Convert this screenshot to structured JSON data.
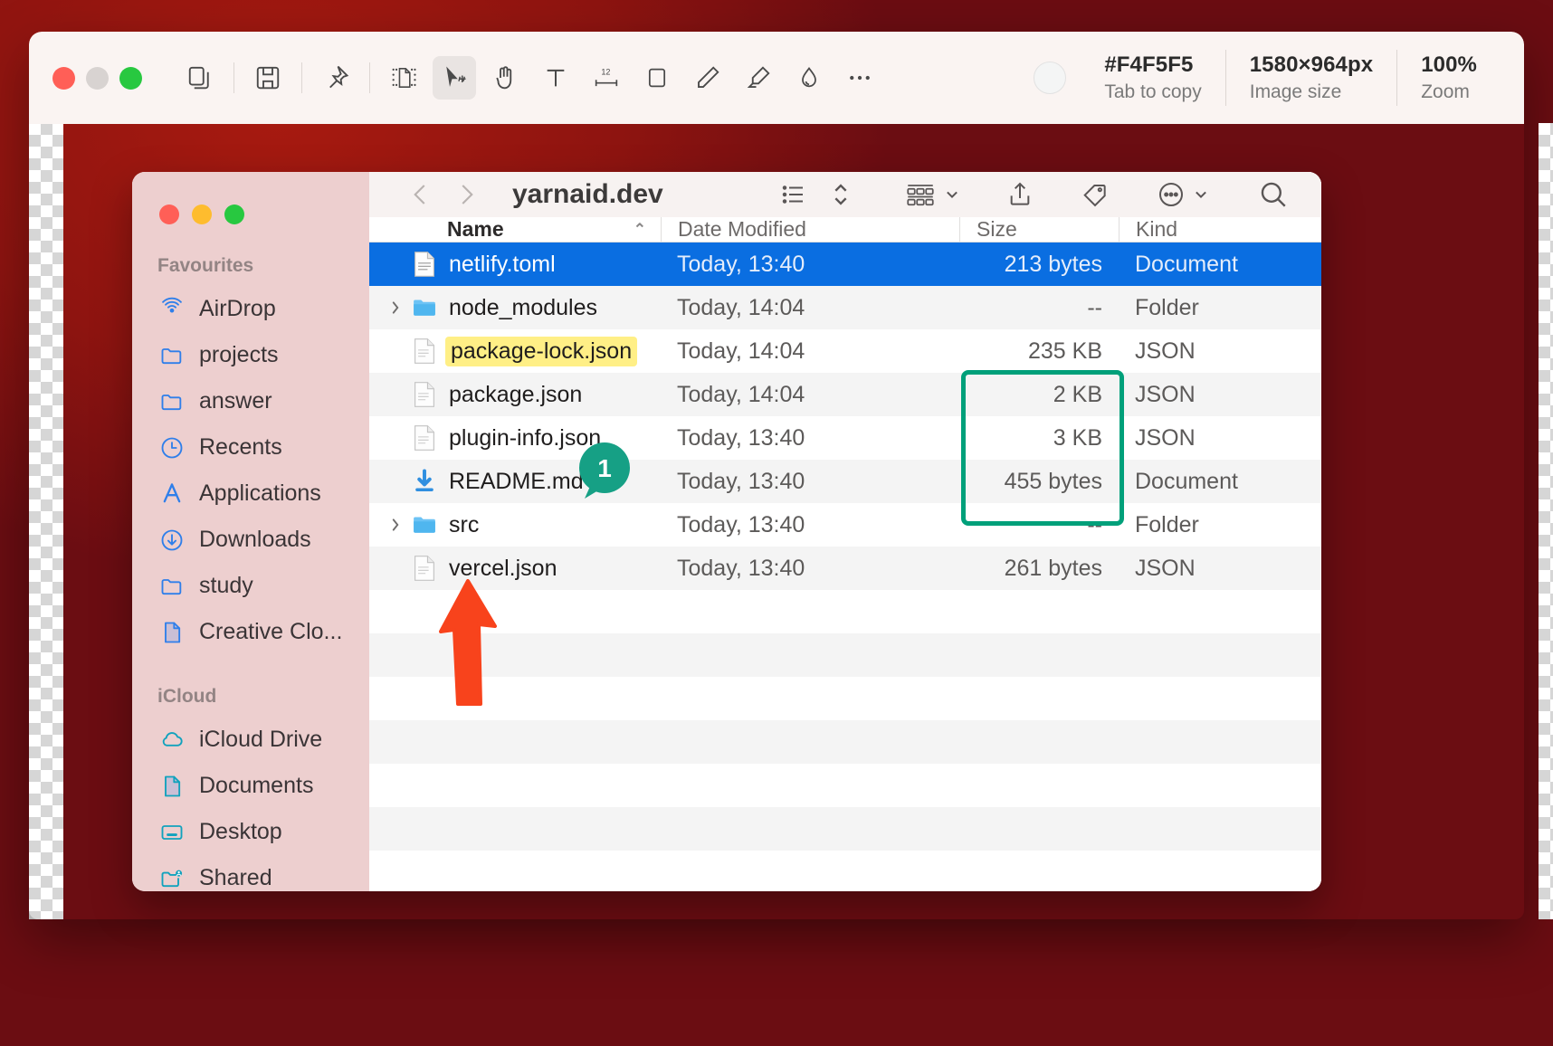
{
  "editor": {
    "window_controls": [
      "close",
      "minimize",
      "zoom"
    ],
    "tools": [
      {
        "name": "copy-icon",
        "label": "Copy"
      },
      {
        "name": "save-icon",
        "label": "Save"
      },
      {
        "name": "pin-icon",
        "label": "Pin"
      },
      {
        "name": "crop-icon",
        "label": "Crop"
      },
      {
        "name": "arrow-cursor-icon",
        "label": "Select",
        "active": true
      },
      {
        "name": "hand-pointer-icon",
        "label": "Pointer"
      },
      {
        "name": "text-icon",
        "label": "Text"
      },
      {
        "name": "measure-icon",
        "label": "Measure"
      },
      {
        "name": "rectangle-icon",
        "label": "Rectangle"
      },
      {
        "name": "pen-icon",
        "label": "Pen"
      },
      {
        "name": "highlighter-icon",
        "label": "Highlighter"
      },
      {
        "name": "blur-icon",
        "label": "Blur"
      },
      {
        "name": "more-icon",
        "label": "More"
      }
    ],
    "color": {
      "hex": "#F4F5F5",
      "caption": "Tab to copy",
      "swatch": "#F4F5F5"
    },
    "image_size": {
      "value": "1580×964px",
      "caption": "Image size"
    },
    "zoom": {
      "value": "100%",
      "caption": "Zoom"
    }
  },
  "finder": {
    "title": "yarnaid.dev",
    "nav": {
      "back": "‹",
      "forward": "›"
    },
    "toolbar_buttons": [
      {
        "name": "list-view-icon",
        "label": "View as list"
      },
      {
        "name": "sort-chevrons-icon",
        "label": "Sort"
      },
      {
        "name": "group-view-icon",
        "label": "Group"
      },
      {
        "name": "share-icon",
        "label": "Share"
      },
      {
        "name": "tag-icon",
        "label": "Tags"
      },
      {
        "name": "more-actions-icon",
        "label": "More"
      },
      {
        "name": "search-icon",
        "label": "Search"
      }
    ],
    "sidebar": {
      "sections": [
        {
          "title": "Favourites",
          "items": [
            {
              "label": "AirDrop",
              "icon": "airdrop-icon",
              "color": "#2f7fea"
            },
            {
              "label": "projects",
              "icon": "folder-icon",
              "color": "#2f7fea"
            },
            {
              "label": "answer",
              "icon": "folder-icon",
              "color": "#2f7fea"
            },
            {
              "label": "Recents",
              "icon": "clock-icon",
              "color": "#2f7fea"
            },
            {
              "label": "Applications",
              "icon": "applications-icon",
              "color": "#2f7fea"
            },
            {
              "label": "Downloads",
              "icon": "download-icon",
              "color": "#2f7fea"
            },
            {
              "label": "study",
              "icon": "folder-icon",
              "color": "#2f7fea"
            },
            {
              "label": "Creative Clo...",
              "icon": "document-icon",
              "color": "#2f7fea"
            }
          ]
        },
        {
          "title": "iCloud",
          "items": [
            {
              "label": "iCloud Drive",
              "icon": "cloud-icon",
              "color": "#11a2bd"
            },
            {
              "label": "Documents",
              "icon": "document-icon",
              "color": "#11a2bd"
            },
            {
              "label": "Desktop",
              "icon": "desktop-icon",
              "color": "#11a2bd"
            },
            {
              "label": "Shared",
              "icon": "shared-folder-icon",
              "color": "#11a2bd"
            }
          ]
        }
      ]
    },
    "columns": [
      "Name",
      "Date Modified",
      "Size",
      "Kind"
    ],
    "sort_indicator": "⌃",
    "files": [
      {
        "name": "netlify.toml",
        "date": "Today, 13:40",
        "size": "213 bytes",
        "kind": "Document",
        "icon": "text-file-icon",
        "selected": true,
        "expandable": false,
        "highlighted": false
      },
      {
        "name": "node_modules",
        "date": "Today, 14:04",
        "size": "--",
        "kind": "Folder",
        "icon": "folder-icon",
        "selected": false,
        "expandable": true,
        "highlighted": false
      },
      {
        "name": "package-lock.json",
        "date": "Today, 14:04",
        "size": "235 KB",
        "kind": "JSON",
        "icon": "json-file-icon",
        "selected": false,
        "expandable": false,
        "highlighted": true
      },
      {
        "name": "package.json",
        "date": "Today, 14:04",
        "size": "2 KB",
        "kind": "JSON",
        "icon": "json-file-icon",
        "selected": false,
        "expandable": false,
        "highlighted": false
      },
      {
        "name": "plugin-info.json",
        "date": "Today, 13:40",
        "size": "3 KB",
        "kind": "JSON",
        "icon": "json-file-icon",
        "selected": false,
        "expandable": false,
        "highlighted": false
      },
      {
        "name": "README.md",
        "date": "Today, 13:40",
        "size": "455 bytes",
        "kind": "Document",
        "icon": "markdown-file-icon",
        "selected": false,
        "expandable": false,
        "highlighted": false
      },
      {
        "name": "src",
        "date": "Today, 13:40",
        "size": "--",
        "kind": "Folder",
        "icon": "folder-icon",
        "selected": false,
        "expandable": true,
        "highlighted": false
      },
      {
        "name": "vercel.json",
        "date": "Today, 13:40",
        "size": "261 bytes",
        "kind": "JSON",
        "icon": "json-file-icon",
        "selected": false,
        "expandable": false,
        "highlighted": false
      }
    ]
  },
  "annotations": {
    "size_box": {
      "color": "#00a07a",
      "target": "size-column"
    },
    "step_badge": {
      "label": "1",
      "color": "#16a085"
    },
    "arrow": {
      "color": "#f8431c",
      "direction": "up",
      "target": "vercel.json"
    },
    "name_highlight": {
      "color": "#ffef86",
      "target": "package-lock.json"
    }
  }
}
